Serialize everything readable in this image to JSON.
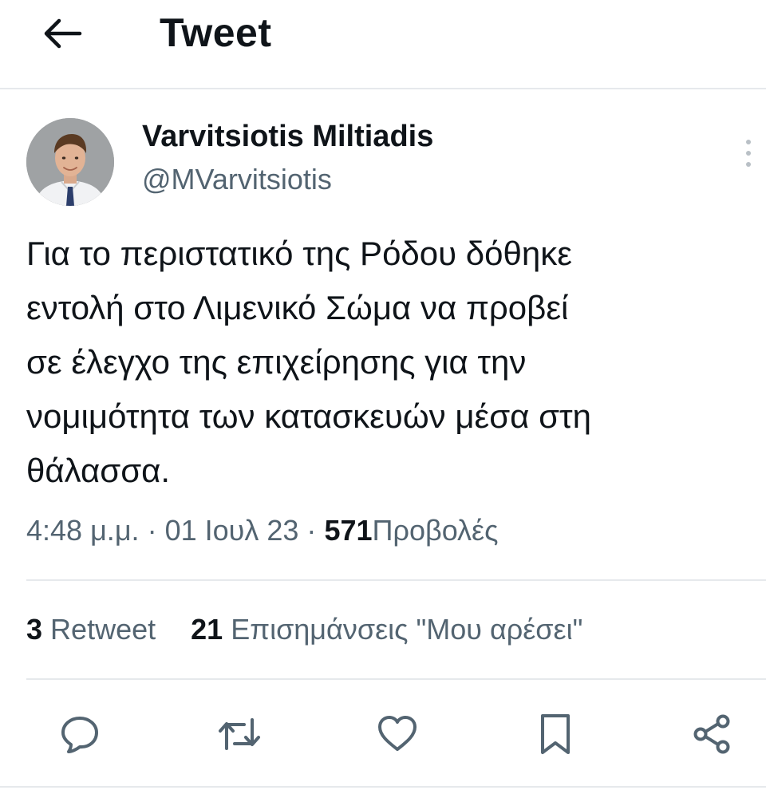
{
  "header": {
    "title": "Tweet",
    "back_icon": "arrow-left-icon"
  },
  "author": {
    "name": "Varvitsiotis Miltiadis",
    "handle": "@MVarvitsiotis",
    "avatar_icon": "profile-photo"
  },
  "tweet": {
    "text": "Για το περιστατικό της Ρόδου δόθηκε\nεντολή στο Λιμενικό Σώμα να προβεί\nσε έλεγχο της επιχείρησης για την\nνομιμότητα των κατασκευών μέσα στη\nθάλασσα."
  },
  "meta": {
    "time": "4:48 μ.μ.",
    "separator": "·",
    "date": "01 Ιουλ 23",
    "views_count": "571",
    "views_label": "Προβολές"
  },
  "stats": {
    "retweets_count": "3",
    "retweets_label": "Retweet",
    "likes_count": "21",
    "likes_label": "Επισημάνσεις \"Μου αρέσει\""
  },
  "actions": {
    "reply_icon": "reply-icon",
    "retweet_icon": "retweet-icon",
    "like_icon": "heart-icon",
    "bookmark_icon": "bookmark-icon",
    "share_icon": "share-icon"
  },
  "colors": {
    "text_primary": "#0f1419",
    "text_secondary": "#536471",
    "divider": "#e6e9ec"
  }
}
